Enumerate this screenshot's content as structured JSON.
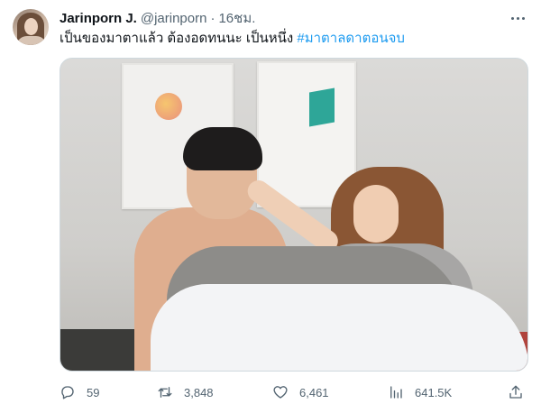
{
  "author": {
    "name": "Jarinporn J.",
    "handle": "@jarinporn",
    "separator": "·",
    "time": "16ชม."
  },
  "tweet": {
    "text": "เป็นของมาตาแล้ว ต้องอดทนนะ เป็นหนึ่ง ",
    "hashtag": "#มาตาลดาตอนจบ"
  },
  "actions": {
    "replies": "59",
    "retweets": "3,848",
    "likes": "6,461",
    "views": "641.5K"
  },
  "colors": {
    "text_primary": "#0f1419",
    "text_secondary": "#536471",
    "link": "#1d9bf0",
    "border": "#cfd9de"
  },
  "icons": {
    "more": "more-icon",
    "reply": "reply-icon",
    "retweet": "retweet-icon",
    "like": "heart-icon",
    "views": "views-chart-icon",
    "share": "share-icon"
  }
}
